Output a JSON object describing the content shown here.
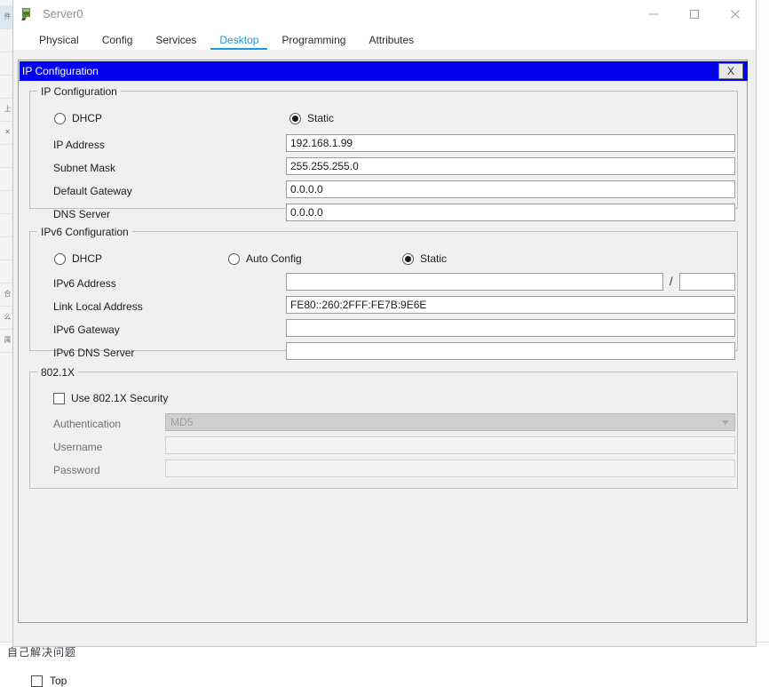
{
  "window": {
    "title": "Server0",
    "icon": "server-device-icon",
    "controls": {
      "minimize": "minimize-icon",
      "maximize": "maximize-icon",
      "close": "close-icon"
    }
  },
  "tabs": [
    {
      "label": "Physical",
      "active": false
    },
    {
      "label": "Config",
      "active": false
    },
    {
      "label": "Services",
      "active": false
    },
    {
      "label": "Desktop",
      "active": true
    },
    {
      "label": "Programming",
      "active": false
    },
    {
      "label": "Attributes",
      "active": false
    }
  ],
  "dialog": {
    "caption": "IP Configuration",
    "close_label": "X"
  },
  "ip_configuration": {
    "group_title": "IP Configuration",
    "mode": {
      "dhcp": {
        "label": "DHCP",
        "selected": false
      },
      "static": {
        "label": "Static",
        "selected": true
      }
    },
    "fields": [
      {
        "label": "IP Address",
        "value": "192.168.1.99"
      },
      {
        "label": "Subnet Mask",
        "value": "255.255.255.0"
      },
      {
        "label": "Default Gateway",
        "value": "0.0.0.0"
      },
      {
        "label": "DNS Server",
        "value": "0.0.0.0"
      }
    ]
  },
  "ipv6_configuration": {
    "group_title": "IPv6 Configuration",
    "mode": {
      "dhcp": {
        "label": "DHCP",
        "selected": false
      },
      "auto_config": {
        "label": "Auto Config",
        "selected": false
      },
      "static": {
        "label": "Static",
        "selected": true
      }
    },
    "address_label": "IPv6 Address",
    "address_value": "",
    "prefix_separator": "/",
    "prefix_value": "",
    "fields": [
      {
        "label": "Link Local Address",
        "value": "FE80::260:2FFF:FE7B:9E6E"
      },
      {
        "label": "IPv6 Gateway",
        "value": ""
      },
      {
        "label": "IPv6 DNS Server",
        "value": ""
      }
    ]
  },
  "dot1x": {
    "group_title": "802.1X",
    "use_security": {
      "label": "Use 802.1X Security",
      "checked": false
    },
    "authentication": {
      "label": "Authentication",
      "value": "MD5",
      "disabled": true
    },
    "username": {
      "label": "Username",
      "value": "",
      "disabled": true
    },
    "password": {
      "label": "Password",
      "value": "",
      "disabled": true
    }
  },
  "footer": {
    "top_checkbox": {
      "label": "Top",
      "checked": false
    }
  },
  "background": {
    "bottom_text": "自己解决问题",
    "left_cells": [
      "件",
      "",
      "",
      "",
      "上",
      "✕",
      "",
      "",
      "",
      "",
      "",
      "",
      "合",
      "么",
      "属"
    ]
  },
  "colors": {
    "accent_tab": "#1e9ad6",
    "dialog_caption": "#0000ee",
    "panel_bg": "#f0f0f0",
    "input_bg": "#ffffff",
    "disabled_bg": "#cfcfcf"
  }
}
